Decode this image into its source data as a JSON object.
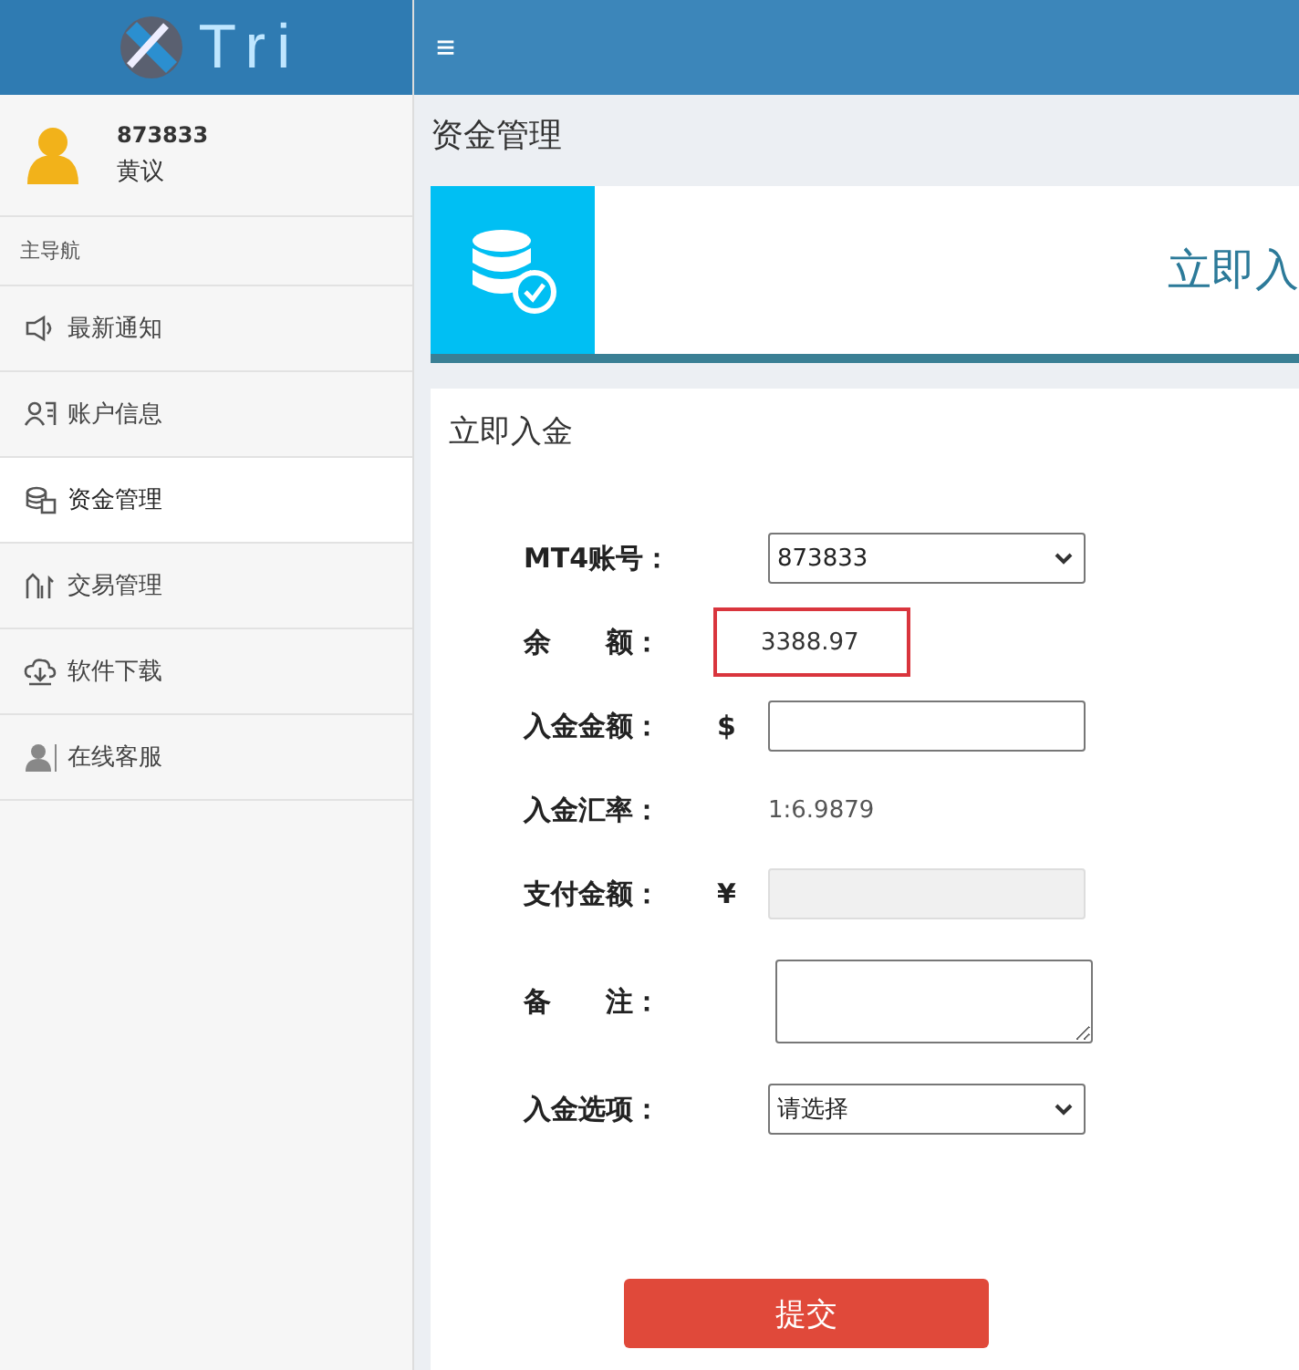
{
  "logo": {
    "text": "Tri"
  },
  "user": {
    "account": "873833",
    "name": "黄议"
  },
  "sidebar": {
    "heading": "主导航",
    "items": [
      {
        "label": "最新通知",
        "kind": "notice",
        "selected": false
      },
      {
        "label": "账户信息",
        "kind": "account",
        "selected": false
      },
      {
        "label": "资金管理",
        "kind": "funds",
        "selected": true
      },
      {
        "label": "交易管理",
        "kind": "trading",
        "selected": false
      },
      {
        "label": "软件下载",
        "kind": "download",
        "selected": false
      },
      {
        "label": "在线客服",
        "kind": "support",
        "selected": false
      }
    ]
  },
  "topbar": {
    "menu_glyph": "≡"
  },
  "page_title": "资金管理",
  "banner": {
    "text": "立即入"
  },
  "form": {
    "title": "立即入金",
    "rows": [
      {
        "kind": "select",
        "label": "MT4账号：",
        "value": "873833"
      },
      {
        "kind": "highlight",
        "label": "余　　额：",
        "value": "3388.97"
      },
      {
        "kind": "input",
        "label": "入金金额：",
        "prefix": "$",
        "disabled": false
      },
      {
        "kind": "text",
        "label": "入金汇率：",
        "value": "1:6.9879"
      },
      {
        "kind": "input",
        "label": "支付金额：",
        "prefix": "¥",
        "disabled": true
      },
      {
        "kind": "textarea",
        "label": "备　　注："
      },
      {
        "kind": "select",
        "label": "入金选项：",
        "value": "请选择"
      }
    ],
    "submit": "提交"
  }
}
